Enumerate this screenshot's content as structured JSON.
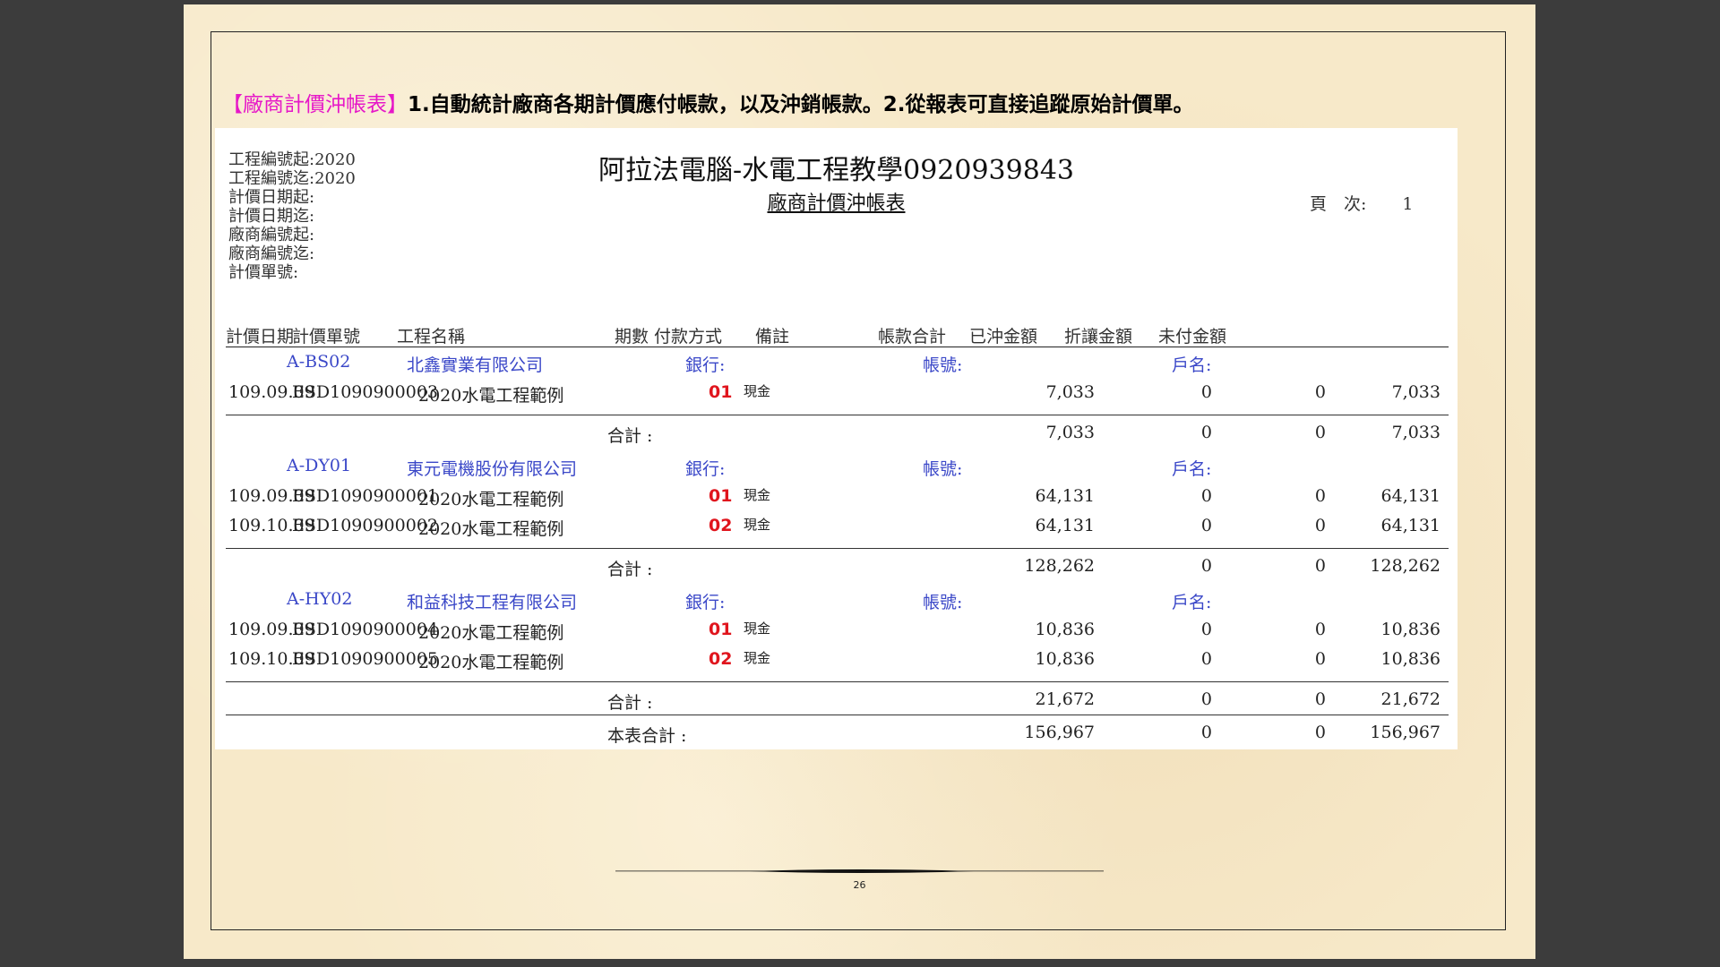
{
  "headline": {
    "tag": "【廠商計價沖帳表】",
    "text": "1.自動統計廠商各期計價應付帳款，以及沖銷帳款。2.從報表可直接追蹤原始計價單。"
  },
  "report": {
    "title": "阿拉法電腦-水電工程教學0920939843",
    "subtitle": "廠商計價沖帳表",
    "page_label": "頁　次:",
    "page_number": "1",
    "params": [
      "工程編號起:2020",
      "工程編號迄:2020",
      "計價日期起:",
      "計價日期迄:",
      "廠商編號起:",
      "廠商編號迄:",
      "計價單號:"
    ],
    "columns": {
      "date": "計價日期",
      "no": "計價單號",
      "project": "工程名稱",
      "period": "期數",
      "pay": "付款方式",
      "note": "備註",
      "total": "帳款合計",
      "paid": "已沖金額",
      "discount": "折讓金額",
      "unpaid": "未付金額"
    },
    "bank_label": "銀行:",
    "account_label": "帳號:",
    "holder_label": "戶名:",
    "subtotal_label": "合計 :",
    "grand_label": "本表合計 :",
    "groups": [
      {
        "code": "A-BS02",
        "name": "北鑫實業有限公司",
        "rows": [
          {
            "date": "109.09.09",
            "no": "ESD1090900003",
            "project": "2020水電工程範例",
            "period": "01",
            "pay": "現金",
            "total": "7,033",
            "paid": "0",
            "discount": "0",
            "unpaid": "7,033"
          }
        ],
        "subtotal": {
          "total": "7,033",
          "paid": "0",
          "discount": "0",
          "unpaid": "7,033"
        }
      },
      {
        "code": "A-DY01",
        "name": "東元電機股份有限公司",
        "rows": [
          {
            "date": "109.09.09",
            "no": "ESD1090900001",
            "project": "2020水電工程範例",
            "period": "01",
            "pay": "現金",
            "total": "64,131",
            "paid": "0",
            "discount": "0",
            "unpaid": "64,131"
          },
          {
            "date": "109.10.09",
            "no": "ESD1090900002",
            "project": "2020水電工程範例",
            "period": "02",
            "pay": "現金",
            "total": "64,131",
            "paid": "0",
            "discount": "0",
            "unpaid": "64,131"
          }
        ],
        "subtotal": {
          "total": "128,262",
          "paid": "0",
          "discount": "0",
          "unpaid": "128,262"
        }
      },
      {
        "code": "A-HY02",
        "name": "和益科技工程有限公司",
        "rows": [
          {
            "date": "109.09.09",
            "no": "ESD1090900004",
            "project": "2020水電工程範例",
            "period": "01",
            "pay": "現金",
            "total": "10,836",
            "paid": "0",
            "discount": "0",
            "unpaid": "10,836"
          },
          {
            "date": "109.10.09",
            "no": "ESD1090900005",
            "project": "2020水電工程範例",
            "period": "02",
            "pay": "現金",
            "total": "10,836",
            "paid": "0",
            "discount": "0",
            "unpaid": "10,836"
          }
        ],
        "subtotal": {
          "total": "21,672",
          "paid": "0",
          "discount": "0",
          "unpaid": "21,672"
        }
      }
    ],
    "grand_total": {
      "total": "156,967",
      "paid": "0",
      "discount": "0",
      "unpaid": "156,967"
    }
  },
  "footer": {
    "page_number": "26"
  }
}
